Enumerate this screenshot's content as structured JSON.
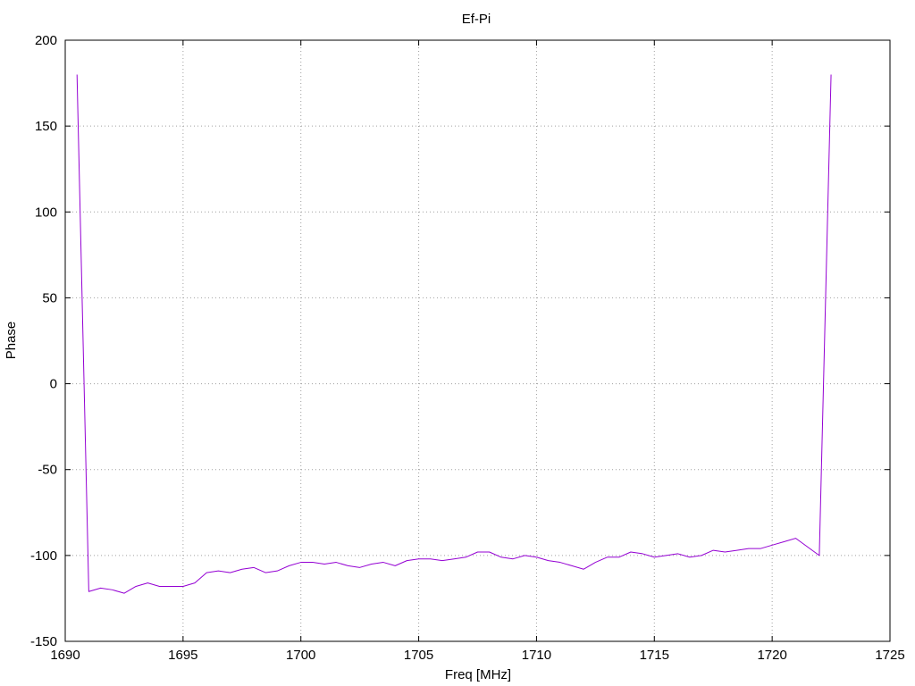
{
  "chart_data": {
    "type": "line",
    "title": "Ef-Pi",
    "xlabel": "Freq [MHz]",
    "ylabel": "Phase",
    "xlim": [
      1690,
      1725
    ],
    "ylim": [
      -150,
      200
    ],
    "x_ticks": [
      1690,
      1695,
      1700,
      1705,
      1710,
      1715,
      1720,
      1725
    ],
    "y_ticks": [
      -150,
      -100,
      -50,
      0,
      50,
      100,
      150,
      200
    ],
    "grid": true,
    "series": [
      {
        "color": "#9400d3",
        "points": [
          [
            1690.5,
            180
          ],
          [
            1691.0,
            -121
          ],
          [
            1691.5,
            -119
          ],
          [
            1692.0,
            -120
          ],
          [
            1692.5,
            -122
          ],
          [
            1693.0,
            -118
          ],
          [
            1693.5,
            -116
          ],
          [
            1694.0,
            -118
          ],
          [
            1694.5,
            -118
          ],
          [
            1695.0,
            -118
          ],
          [
            1695.5,
            -116
          ],
          [
            1696.0,
            -110
          ],
          [
            1696.5,
            -109
          ],
          [
            1697.0,
            -110
          ],
          [
            1697.5,
            -108
          ],
          [
            1698.0,
            -107
          ],
          [
            1698.5,
            -110
          ],
          [
            1699.0,
            -109
          ],
          [
            1699.5,
            -106
          ],
          [
            1700.0,
            -104
          ],
          [
            1700.5,
            -104
          ],
          [
            1701.0,
            -105
          ],
          [
            1701.5,
            -104
          ],
          [
            1702.0,
            -106
          ],
          [
            1702.5,
            -107
          ],
          [
            1703.0,
            -105
          ],
          [
            1703.5,
            -104
          ],
          [
            1704.0,
            -106
          ],
          [
            1704.5,
            -103
          ],
          [
            1705.0,
            -102
          ],
          [
            1705.5,
            -102
          ],
          [
            1706.0,
            -103
          ],
          [
            1706.5,
            -102
          ],
          [
            1707.0,
            -101
          ],
          [
            1707.5,
            -98
          ],
          [
            1708.0,
            -98
          ],
          [
            1708.5,
            -101
          ],
          [
            1709.0,
            -102
          ],
          [
            1709.5,
            -100
          ],
          [
            1710.0,
            -101
          ],
          [
            1710.5,
            -103
          ],
          [
            1711.0,
            -104
          ],
          [
            1711.5,
            -106
          ],
          [
            1712.0,
            -108
          ],
          [
            1712.5,
            -104
          ],
          [
            1713.0,
            -101
          ],
          [
            1713.5,
            -101
          ],
          [
            1714.0,
            -98
          ],
          [
            1714.5,
            -99
          ],
          [
            1715.0,
            -101
          ],
          [
            1715.5,
            -100
          ],
          [
            1716.0,
            -99
          ],
          [
            1716.5,
            -101
          ],
          [
            1717.0,
            -100
          ],
          [
            1717.5,
            -97
          ],
          [
            1718.0,
            -98
          ],
          [
            1718.5,
            -97
          ],
          [
            1719.0,
            -96
          ],
          [
            1719.5,
            -96
          ],
          [
            1720.0,
            -94
          ],
          [
            1720.5,
            -92
          ],
          [
            1721.0,
            -90
          ],
          [
            1722.0,
            -100
          ],
          [
            1722.5,
            180
          ]
        ]
      }
    ]
  }
}
